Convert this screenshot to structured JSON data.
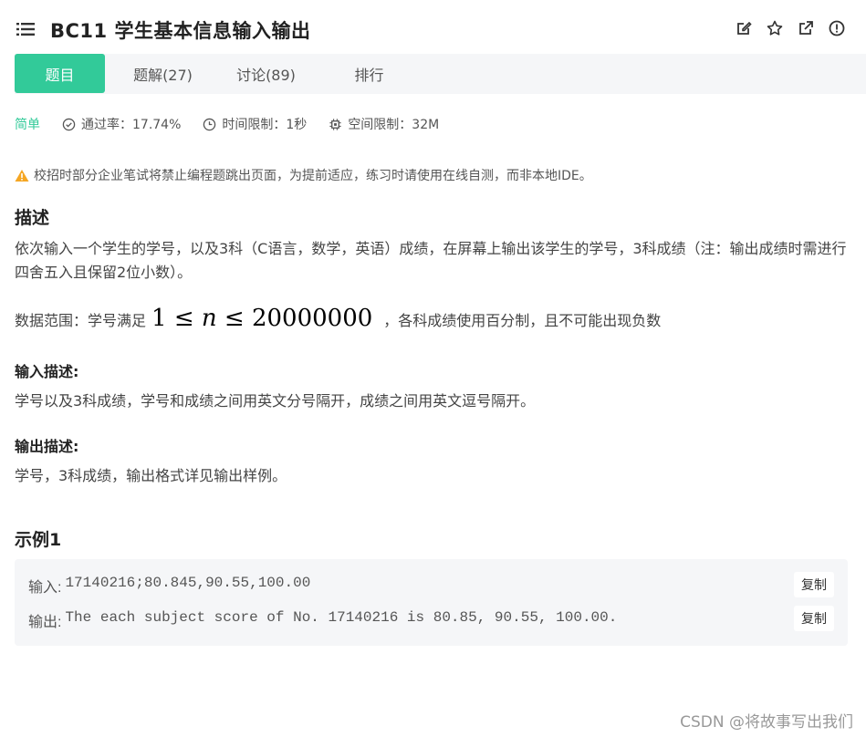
{
  "header": {
    "title": "BC11  学生基本信息输入输出",
    "icons": [
      "list-icon",
      "edit-icon",
      "star-icon",
      "external-link-icon",
      "info-icon"
    ]
  },
  "tabs": [
    {
      "label": "题目",
      "active": true
    },
    {
      "label": "题解(27)",
      "active": false
    },
    {
      "label": "讨论(89)",
      "active": false
    },
    {
      "label": "排行",
      "active": false
    }
  ],
  "meta": {
    "level": "简单",
    "pass_rate": "通过率：17.74%",
    "time_limit": "时间限制：1秒",
    "space_limit": "空间限制：32M"
  },
  "notice": "校招时部分企业笔试将禁止编程题跳出页面，为提前适应，练习时请使用在线自测，而非本地IDE。",
  "description": {
    "heading": "描述",
    "text": "依次输入一个学生的学号，以及3科（C语言，数学，英语）成绩，在屏幕上输出该学生的学号，3科成绩（注：输出成绩时需进行四舍五入且保留2位小数）。",
    "range_prefix": "数据范围：学号满足",
    "range_math_left": "1 ≤ ",
    "range_math_var": "n",
    "range_math_right": " ≤ 20000000",
    "range_suffix": "，各科成绩使用百分制，且不可能出现负数"
  },
  "input_desc": {
    "heading": "输入描述:",
    "text": "学号以及3科成绩，学号和成绩之间用英文分号隔开，成绩之间用英文逗号隔开。"
  },
  "output_desc": {
    "heading": "输出描述:",
    "text": "学号，3科成绩，输出格式详见输出样例。"
  },
  "example": {
    "heading": "示例1",
    "input_label": "输入:",
    "input_value": "17140216;80.845,90.55,100.00",
    "output_label": "输出:",
    "output_value": "The each subject score of No. 17140216 is 80.85, 90.55, 100.00.",
    "copy_label": "复制"
  },
  "watermark": "CSDN @将故事写出我们",
  "colors": {
    "accent": "#32ca99",
    "tab_bg": "#f5f6f8",
    "warning": "#f5a623"
  }
}
